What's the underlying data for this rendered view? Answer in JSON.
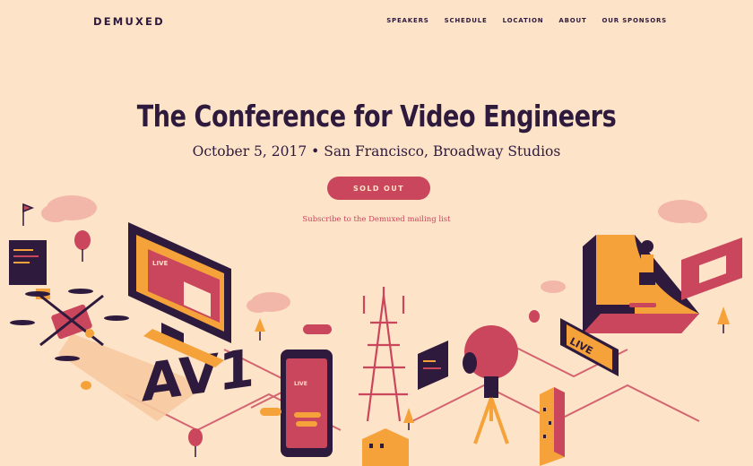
{
  "brand": {
    "logo": "DEMUXED"
  },
  "nav": {
    "items": [
      "SPEAKERS",
      "SCHEDULE",
      "LOCATION",
      "ABOUT",
      "OUR SPONSORS"
    ]
  },
  "hero": {
    "title": "The Conference for Video Engineers",
    "subtitle": "October 5, 2017 • San Francisco, Broadway Studios",
    "button": "SOLD OUT",
    "subscribe": "Subscribe to the Demuxed mailing list"
  },
  "illustration": {
    "monitor_label": "LIVE",
    "phone_label": "LIVE",
    "badge_label": "LIVE",
    "codec_text": "AV1"
  },
  "colors": {
    "background": "#fde3c8",
    "navy": "#2e1a3c",
    "accent": "#c9465c",
    "orange": "#f5a23a"
  }
}
